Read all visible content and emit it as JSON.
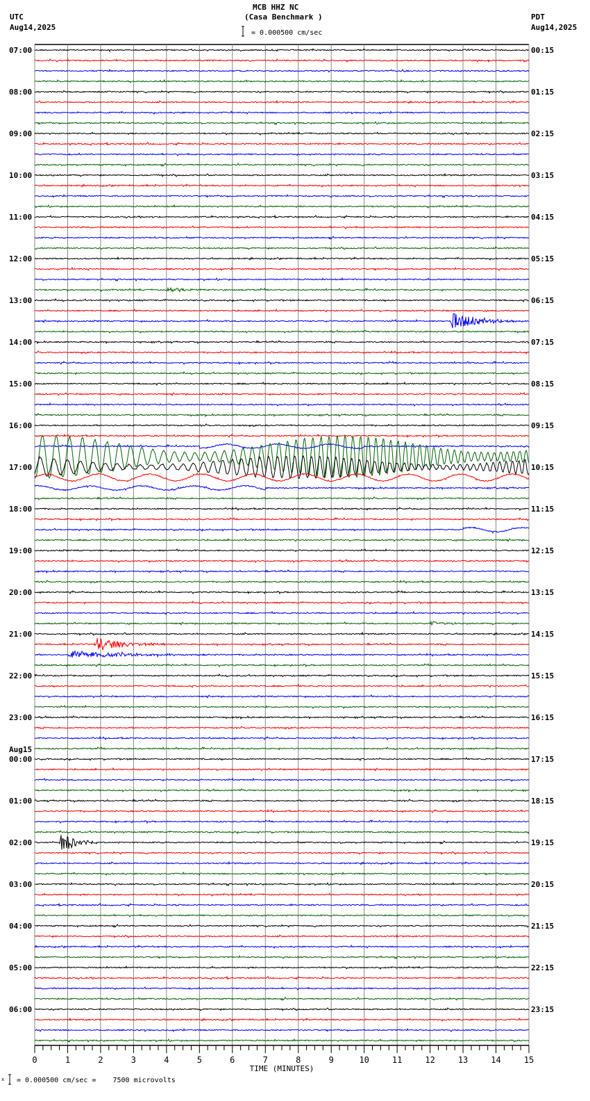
{
  "header": {
    "title": "MCB HHZ NC",
    "subtitle": "(Casa Benchmark )",
    "scale": "= 0.000500 cm/sec",
    "left_tz": "UTC",
    "left_date": "Aug14,2025",
    "right_tz": "PDT",
    "right_date": "Aug14,2025"
  },
  "footer": {
    "scale": "= 0.000500 cm/sec =    7500 microvolts",
    "prefix": "x"
  },
  "chart_data": {
    "type": "line",
    "title": "MCB HHZ NC (Casa Benchmark )",
    "xlabel": "TIME (MINUTES)",
    "xlim": [
      0,
      15
    ],
    "x_ticks": [
      "0",
      "1",
      "2",
      "3",
      "4",
      "5",
      "6",
      "7",
      "8",
      "9",
      "10",
      "11",
      "12",
      "13",
      "14",
      "15"
    ],
    "traces_per_hour": 4,
    "trace_count": 96,
    "trace_colors": [
      "#000000",
      "#ff0000",
      "#0000ff",
      "#006400"
    ],
    "left_labels": [
      "07:00",
      "08:00",
      "09:00",
      "10:00",
      "11:00",
      "12:00",
      "13:00",
      "14:00",
      "15:00",
      "16:00",
      "17:00",
      "18:00",
      "19:00",
      "20:00",
      "21:00",
      "22:00",
      "23:00",
      "00:00",
      "01:00",
      "02:00",
      "03:00",
      "04:00",
      "05:00",
      "06:00"
    ],
    "date_change_label": "Aug15",
    "right_labels": [
      "00:15",
      "01:15",
      "02:15",
      "03:15",
      "04:15",
      "05:15",
      "06:15",
      "07:15",
      "08:15",
      "09:15",
      "10:15",
      "11:15",
      "12:15",
      "13:15",
      "14:15",
      "15:15",
      "16:15",
      "17:15",
      "18:15",
      "19:15",
      "20:15",
      "21:15",
      "22:15",
      "23:15"
    ],
    "events": [
      {
        "trace": 23,
        "start": 4.0,
        "end": 6.5,
        "amplitude": 3,
        "type": "burst"
      },
      {
        "trace": 26,
        "start": 12.6,
        "end": 15,
        "amplitude": 14,
        "type": "burst"
      },
      {
        "trace": 38,
        "start": 5.0,
        "end": 10.0,
        "amplitude": 3,
        "type": "swell"
      },
      {
        "trace": 39,
        "start": 0,
        "end": 15,
        "amplitude": 30,
        "type": "surface"
      },
      {
        "trace": 40,
        "start": 0,
        "end": 15,
        "amplitude": 16,
        "type": "surface"
      },
      {
        "trace": 41,
        "start": 0,
        "end": 15,
        "amplitude": 5,
        "type": "swell"
      },
      {
        "trace": 42,
        "start": 0,
        "end": 7,
        "amplitude": 3,
        "type": "swell"
      },
      {
        "trace": 46,
        "start": 13.0,
        "end": 15,
        "amplitude": 3,
        "type": "swell"
      },
      {
        "trace": 55,
        "start": 12.0,
        "end": 13.2,
        "amplitude": 3,
        "type": "burst"
      },
      {
        "trace": 57,
        "start": 1.8,
        "end": 4.6,
        "amplitude": 10,
        "type": "burst"
      },
      {
        "trace": 58,
        "start": 1.0,
        "end": 5.6,
        "amplitude": 6,
        "type": "burst"
      },
      {
        "trace": 76,
        "start": 0.75,
        "end": 2.0,
        "amplitude": 18,
        "type": "burst"
      }
    ]
  }
}
